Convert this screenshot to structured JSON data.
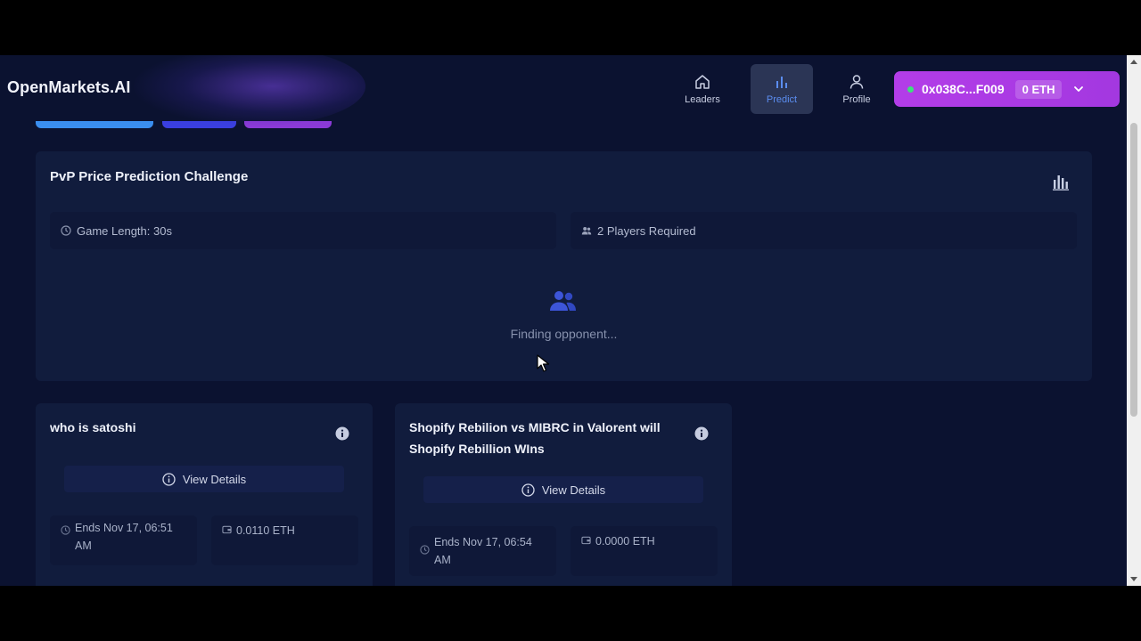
{
  "app": {
    "brand": "OpenMarkets.AI"
  },
  "nav": {
    "items": [
      {
        "label": "Leaders",
        "icon": "home-icon"
      },
      {
        "label": "Predict",
        "icon": "bar-chart-icon",
        "active": true
      },
      {
        "label": "Profile",
        "icon": "user-icon"
      }
    ]
  },
  "wallet": {
    "address": "0x038C...F009",
    "balance": "0 ETH"
  },
  "pvp": {
    "title": "PvP Price Prediction Challenge",
    "game_length": "Game Length: 30s",
    "players": "2 Players Required",
    "status": "Finding opponent..."
  },
  "markets": [
    {
      "title": "who is satoshi",
      "view_label": "View Details",
      "ends": "Ends Nov 17, 06:51 AM",
      "amount": "0.0110 ETH"
    },
    {
      "title": "Shopify Rebilion vs MIBRC in Valorent will Shopify Rebillion WIns",
      "view_label": "View Details",
      "ends": "Ends Nov 17, 06:54 AM",
      "amount": "0.0000 ETH"
    }
  ],
  "colors": {
    "background": "#0b1230",
    "card": "#111c3d",
    "accent_purple": "#b33de8",
    "accent_blue": "#5b8df0"
  }
}
